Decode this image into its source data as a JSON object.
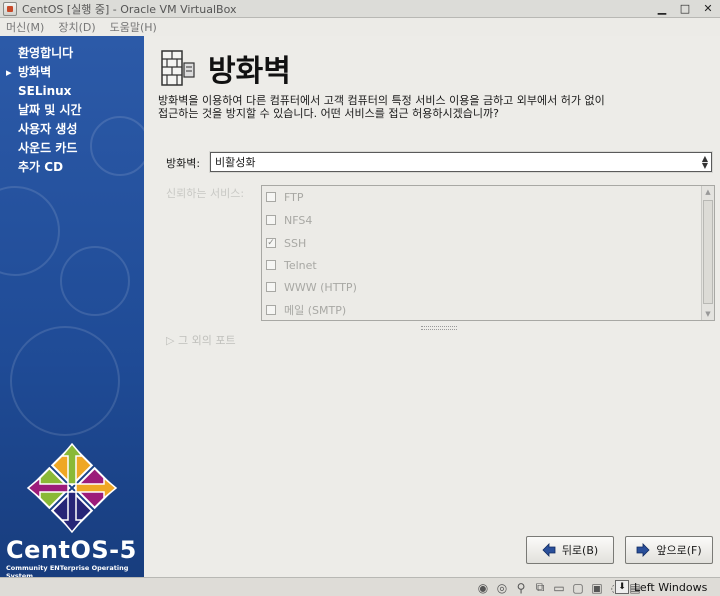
{
  "window": {
    "title": "CentOS [실행 중] - Oracle VM VirtualBox",
    "controls": {
      "minimize": "▁",
      "maximize": "□",
      "close": "✕"
    }
  },
  "menu": [
    "머신(M)",
    "장치(D)",
    "도움말(H)"
  ],
  "sidebar": {
    "items": [
      {
        "label": "환영합니다",
        "active": false
      },
      {
        "label": "방화벽",
        "active": true
      },
      {
        "label": "SELinux",
        "active": false
      },
      {
        "label": "날짜 및 시간",
        "active": false
      },
      {
        "label": "사용자 생성",
        "active": false
      },
      {
        "label": "사운드 카드",
        "active": false
      },
      {
        "label": "추가 CD",
        "active": false
      }
    ],
    "brand": "CentOS-5",
    "tagline": "Community ENTerprise Operating System"
  },
  "main": {
    "title": "방화벽",
    "description": "방화벽을 이용하여 다른 컴퓨터에서 고객 컴퓨터의 특정 서비스 이용을 금하고 외부에서 허가 없이 접근하는 것을 방지할 수 있습니다. 어떤 서비스를 접근 허용하시겠습니까?",
    "firewall_label": "방화벽:",
    "firewall_value": "비활성화",
    "trusted_label": "신뢰하는 서비스:",
    "services": [
      {
        "label": "FTP",
        "checked": false
      },
      {
        "label": "NFS4",
        "checked": false
      },
      {
        "label": "SSH",
        "checked": true
      },
      {
        "label": "Telnet",
        "checked": false
      },
      {
        "label": "WWW (HTTP)",
        "checked": false
      },
      {
        "label": "메일 (SMTP)",
        "checked": false
      }
    ],
    "other_ports": "그 외의 포트",
    "back_button": "뒤로(B)",
    "next_button": "앞으로(F)"
  },
  "status": {
    "host_key": "Left Windows"
  },
  "colors": {
    "sidebar": "#1f4b96",
    "content": "#edece8"
  }
}
